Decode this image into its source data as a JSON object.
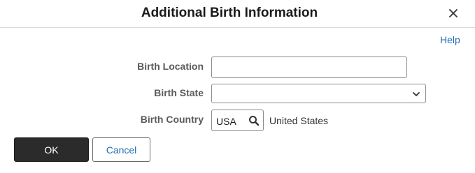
{
  "dialog": {
    "title": "Additional Birth Information",
    "close_icon": "close-icon",
    "help_label": "Help"
  },
  "fields": {
    "birth_location": {
      "label": "Birth Location",
      "value": ""
    },
    "birth_state": {
      "label": "Birth State",
      "selected": "",
      "icon": "chevron-down-icon"
    },
    "birth_country": {
      "label": "Birth Country",
      "code": "USA",
      "description": "United States",
      "icon": "search-icon"
    }
  },
  "buttons": {
    "ok_label": "OK",
    "cancel_label": "Cancel"
  },
  "colors": {
    "link": "#1f6fb5",
    "primary_button": "#2b2b2b",
    "label": "#5a5a5a"
  }
}
